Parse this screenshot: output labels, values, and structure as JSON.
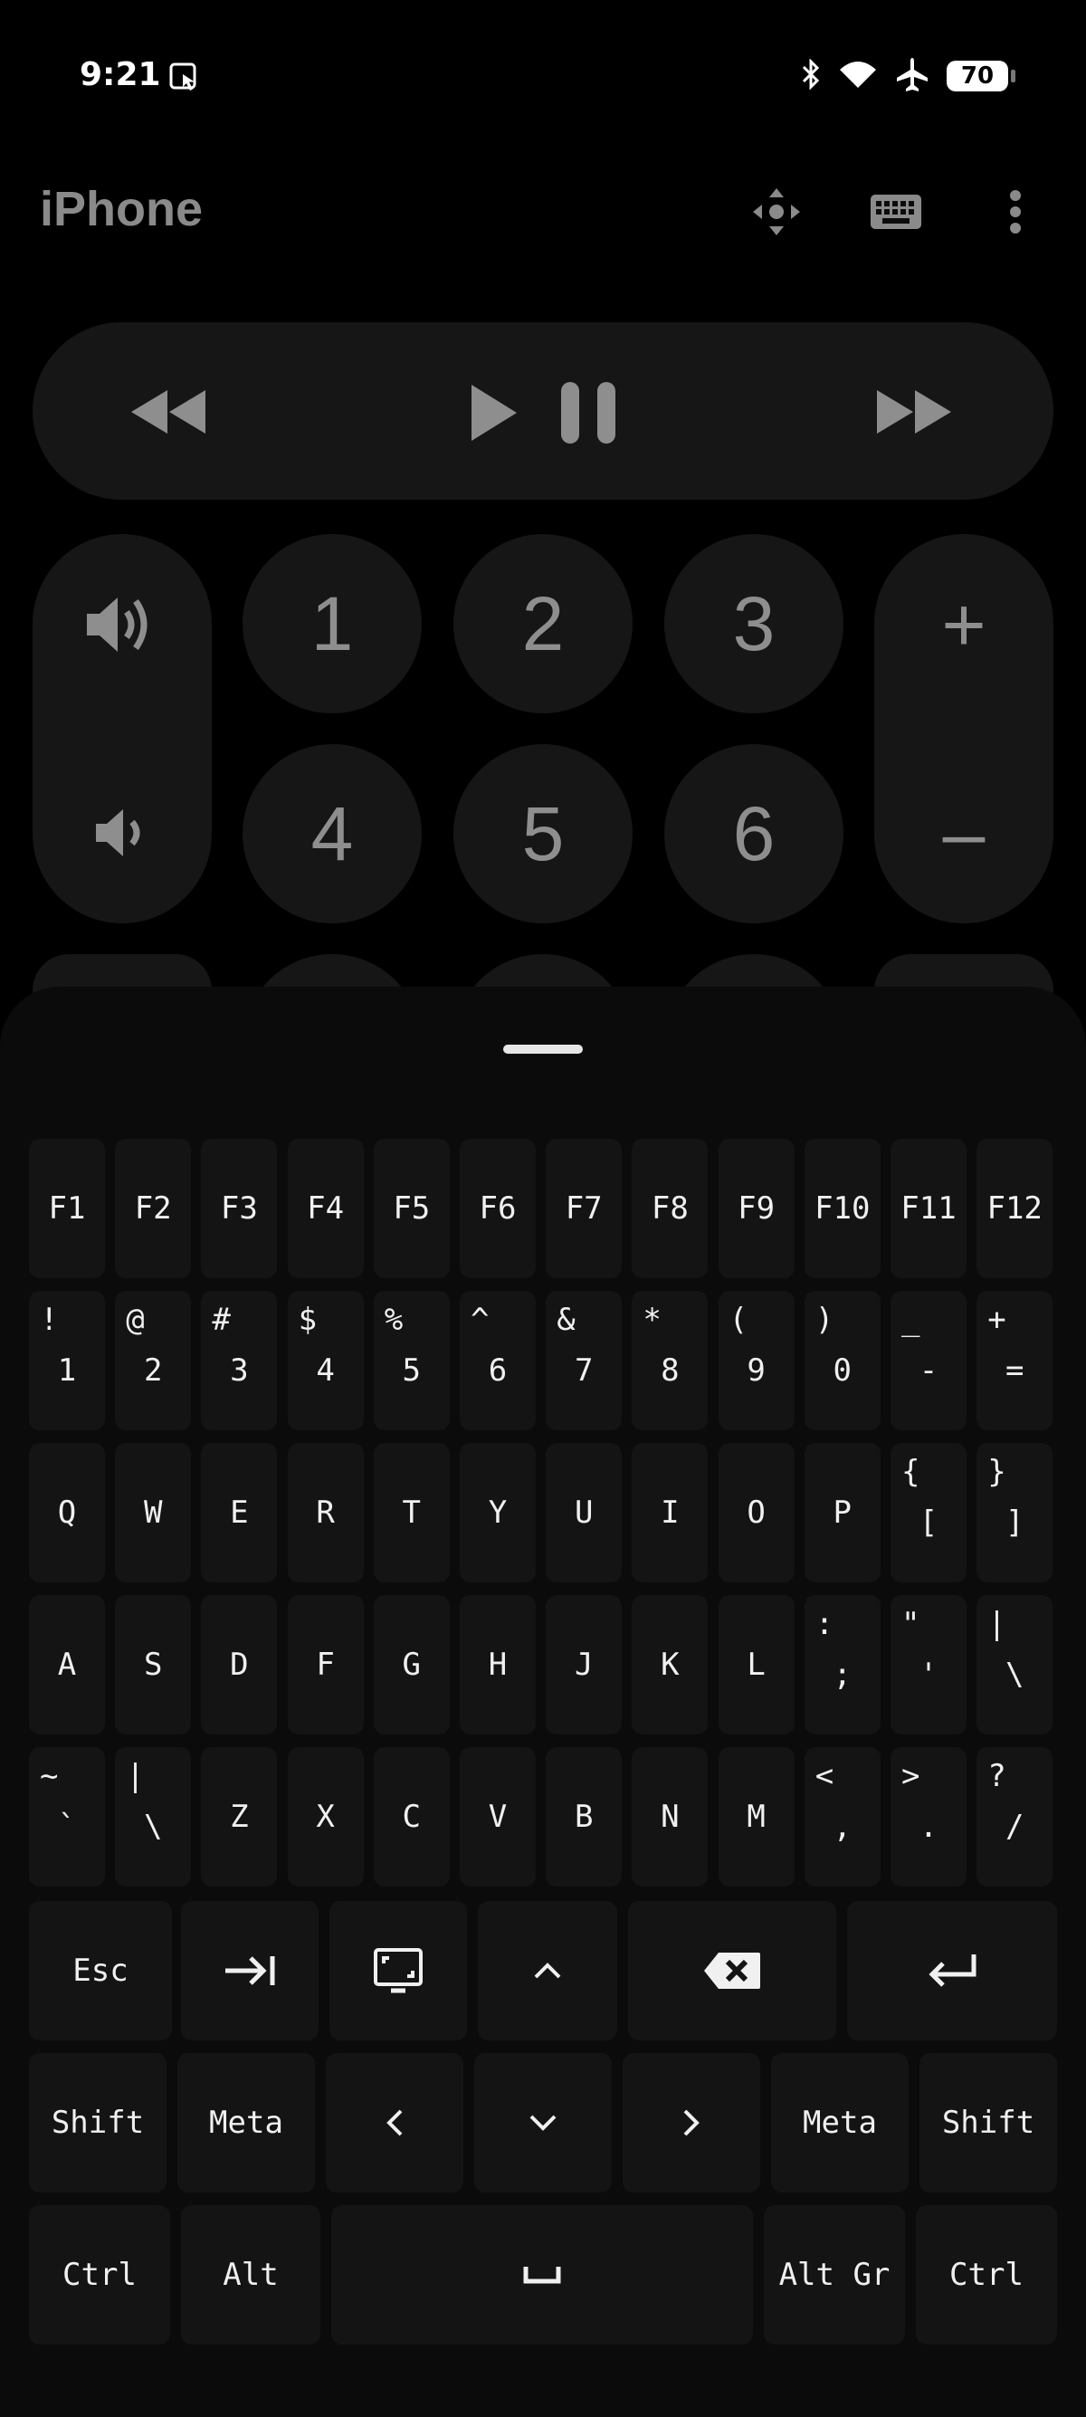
{
  "status": {
    "time": "9:21",
    "battery": "70"
  },
  "app": {
    "title": "iPhone",
    "numbers": [
      "1",
      "2",
      "3",
      "4",
      "5",
      "6"
    ],
    "plus": "+",
    "minus": "–"
  },
  "keyboard": {
    "function_keys": [
      "F1",
      "F2",
      "F3",
      "F4",
      "F5",
      "F6",
      "F7",
      "F8",
      "F9",
      "F10",
      "F11",
      "F12"
    ],
    "number_row": [
      {
        "shift": "!",
        "main": "1"
      },
      {
        "shift": "@",
        "main": "2"
      },
      {
        "shift": "#",
        "main": "3"
      },
      {
        "shift": "$",
        "main": "4"
      },
      {
        "shift": "%",
        "main": "5"
      },
      {
        "shift": "^",
        "main": "6"
      },
      {
        "shift": "&",
        "main": "7"
      },
      {
        "shift": "*",
        "main": "8"
      },
      {
        "shift": "(",
        "main": "9"
      },
      {
        "shift": ")",
        "main": "0"
      },
      {
        "shift": "_",
        "main": "-"
      },
      {
        "shift": "+",
        "main": "="
      }
    ],
    "qwerty_row": [
      {
        "main": "Q"
      },
      {
        "main": "W"
      },
      {
        "main": "E"
      },
      {
        "main": "R"
      },
      {
        "main": "T"
      },
      {
        "main": "Y"
      },
      {
        "main": "U"
      },
      {
        "main": "I"
      },
      {
        "main": "O"
      },
      {
        "main": "P"
      },
      {
        "shift": "{",
        "main": "["
      },
      {
        "shift": "}",
        "main": "]"
      }
    ],
    "home_row": [
      {
        "main": "A"
      },
      {
        "main": "S"
      },
      {
        "main": "D"
      },
      {
        "main": "F"
      },
      {
        "main": "G"
      },
      {
        "main": "H"
      },
      {
        "main": "J"
      },
      {
        "main": "K"
      },
      {
        "main": "L"
      },
      {
        "shift": ":",
        "main": ";"
      },
      {
        "shift": "\"",
        "main": "'"
      },
      {
        "shift": "|",
        "main": "\\"
      }
    ],
    "bottom_row": [
      {
        "shift": "~",
        "main": "`"
      },
      {
        "shift": "|",
        "main": "\\"
      },
      {
        "main": "Z"
      },
      {
        "main": "X"
      },
      {
        "main": "C"
      },
      {
        "main": "V"
      },
      {
        "main": "B"
      },
      {
        "main": "N"
      },
      {
        "main": "M"
      },
      {
        "shift": "<",
        "main": ","
      },
      {
        "shift": ">",
        "main": "."
      },
      {
        "shift": "?",
        "main": "/"
      }
    ],
    "esc": "Esc",
    "shift": "Shift",
    "meta": "Meta",
    "ctrl": "Ctrl",
    "alt": "Alt",
    "alt_gr": "Alt Gr"
  },
  "icons": {
    "status": [
      "screenshot-icon",
      "bluetooth-icon",
      "wifi-icon",
      "airplane-icon"
    ],
    "topbar": [
      "move-icon",
      "keyboard-icon",
      "more-vert-icon"
    ],
    "media": [
      "rewind-icon",
      "play-icon",
      "pause-icon",
      "fast-forward-icon"
    ],
    "volume": [
      "volume-up-icon",
      "volume-down-icon"
    ],
    "special_keys": [
      "tab-icon",
      "window-icon",
      "arrow-up-icon",
      "backspace-icon",
      "enter-icon",
      "arrow-left-icon",
      "arrow-down-icon",
      "arrow-right-icon",
      "space-icon"
    ]
  }
}
